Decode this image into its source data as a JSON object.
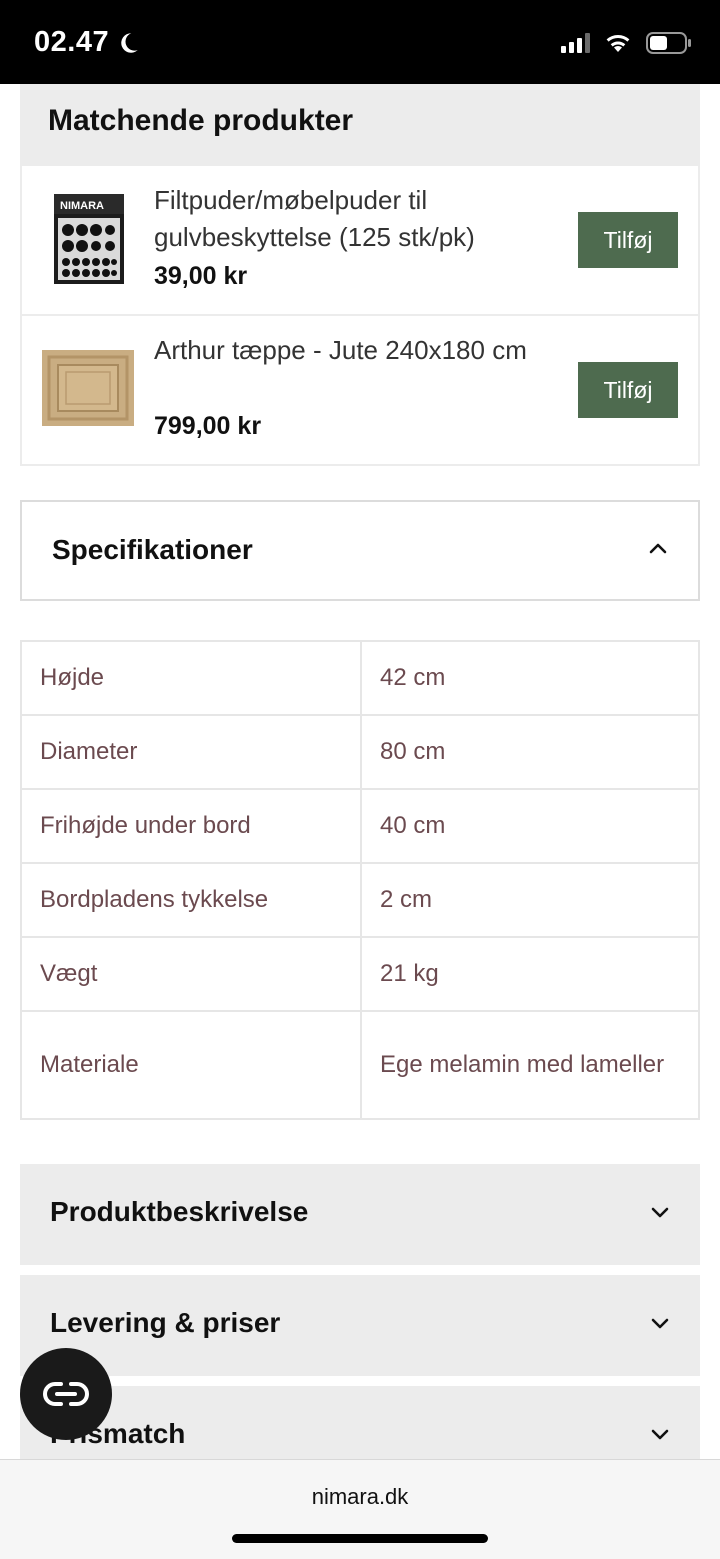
{
  "status_bar": {
    "time": "02.47"
  },
  "matching": {
    "title": "Matchende produkter",
    "products": [
      {
        "name": "Filtpuder/møbelpuder til gulvbeskyttelse (125 stk/pk)",
        "price": "39,00 kr",
        "button": "Tilføj",
        "brand_on_image": "NIMARA"
      },
      {
        "name": "Arthur tæppe - Jute 240x180 cm",
        "price": "799,00 kr",
        "button": "Tilføj"
      }
    ]
  },
  "specs": {
    "title": "Specifikationer",
    "rows": [
      {
        "label": "Højde",
        "value": "42 cm"
      },
      {
        "label": "Diameter",
        "value": "80 cm"
      },
      {
        "label": "Frihøjde under bord",
        "value": "40 cm"
      },
      {
        "label": "Bordpladens tykkelse",
        "value": "2 cm"
      },
      {
        "label": "Vægt",
        "value": "21 kg"
      },
      {
        "label": "Materiale",
        "value": "Ege melamin med lameller"
      }
    ]
  },
  "accordions": [
    {
      "title": "Produktbeskrivelse"
    },
    {
      "title": "Levering & priser"
    },
    {
      "title": "Prismatch"
    }
  ],
  "browser": {
    "url": "nimara.dk"
  },
  "colors": {
    "button": "#4e6b4f",
    "spec_text": "#6b4a4f",
    "panel_gray": "#ececec"
  }
}
